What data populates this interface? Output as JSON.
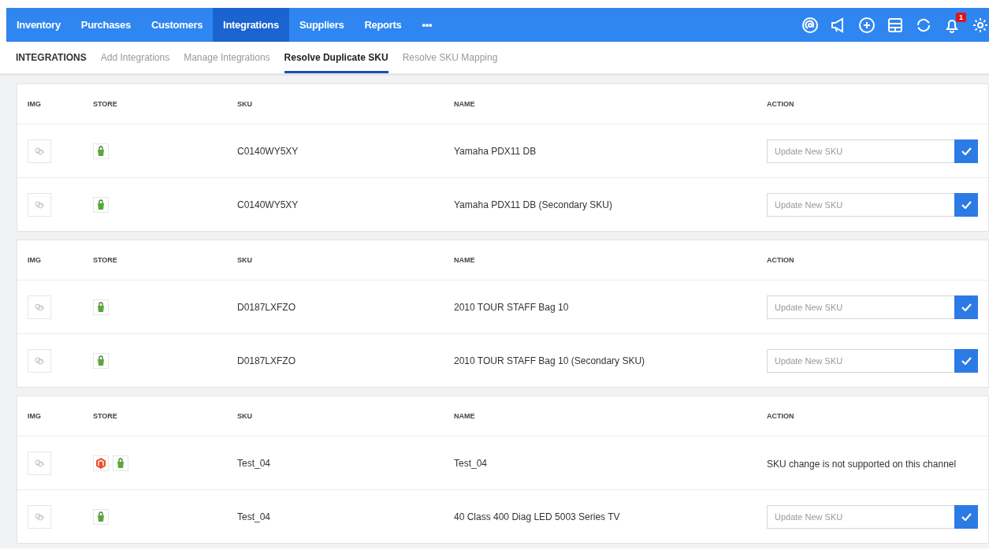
{
  "nav": {
    "items": [
      {
        "label": "Inventory",
        "selected": false
      },
      {
        "label": "Purchases",
        "selected": false
      },
      {
        "label": "Customers",
        "selected": false
      },
      {
        "label": "Integrations",
        "selected": true
      },
      {
        "label": "Suppliers",
        "selected": false
      },
      {
        "label": "Reports",
        "selected": false
      },
      {
        "label": "•••",
        "selected": false
      }
    ],
    "notification_count": "1"
  },
  "subnav": {
    "title": "INTEGRATIONS",
    "tabs": [
      {
        "label": "Add Integrations",
        "selected": false
      },
      {
        "label": "Manage Integrations",
        "selected": false
      },
      {
        "label": "Resolve Duplicate SKU",
        "selected": true
      },
      {
        "label": "Resolve SKU Mapping",
        "selected": false
      }
    ]
  },
  "groups": [
    {
      "columns": [
        "IMG",
        "STORE",
        "SKU",
        "NAME",
        "ACTION"
      ],
      "rows": [
        {
          "stores": [
            {
              "kind": "shopify"
            }
          ],
          "sku": "C0140WY5XY",
          "name": "Yamaha PDX11 DB",
          "action": {
            "kind": "input",
            "placeholder": "Update New SKU"
          }
        },
        {
          "stores": [
            {
              "kind": "shopify"
            }
          ],
          "sku": "C0140WY5XY",
          "name": "Yamaha PDX11 DB (Secondary SKU)",
          "action": {
            "kind": "input",
            "placeholder": "Update New SKU"
          }
        }
      ]
    },
    {
      "columns": [
        "IMG",
        "STORE",
        "SKU",
        "NAME",
        "ACTION"
      ],
      "rows": [
        {
          "stores": [
            {
              "kind": "shopify"
            }
          ],
          "sku": "D0187LXFZO",
          "name": "2010 TOUR STAFF Bag 10",
          "action": {
            "kind": "input",
            "placeholder": "Update New SKU"
          }
        },
        {
          "stores": [
            {
              "kind": "shopify"
            }
          ],
          "sku": "D0187LXFZO",
          "name": "2010 TOUR STAFF Bag 10 (Secondary SKU)",
          "action": {
            "kind": "input",
            "placeholder": "Update New SKU"
          }
        }
      ]
    },
    {
      "columns": [
        "IMG",
        "STORE",
        "SKU",
        "NAME",
        "ACTION"
      ],
      "rows": [
        {
          "stores": [
            {
              "kind": "magento"
            },
            {
              "kind": "shopify"
            }
          ],
          "sku": "Test_04",
          "name": "Test_04",
          "action": {
            "kind": "message",
            "text": "SKU change is not supported on this channel"
          }
        },
        {
          "stores": [
            {
              "kind": "shopify"
            }
          ],
          "sku": "Test_04",
          "name": "40 Class 400 Diag LED 5003 Series TV",
          "action": {
            "kind": "input",
            "placeholder": "Update New SKU"
          }
        }
      ]
    }
  ]
}
